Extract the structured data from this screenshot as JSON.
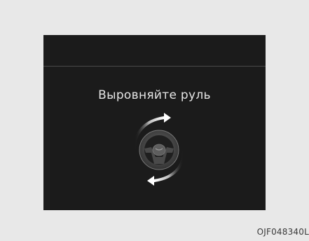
{
  "display": {
    "message": "Выровняйте руль"
  },
  "icons": {
    "center": "steering-wheel-icon",
    "top_arrow": "rotate-clockwise-arrow-icon",
    "bottom_arrow": "rotate-counterclockwise-arrow-icon"
  },
  "figure_code": "OJF048340L",
  "colors": {
    "page_background": "#e8e8e8",
    "display_background": "#1b1b1b",
    "text": "#e6e6e6"
  }
}
